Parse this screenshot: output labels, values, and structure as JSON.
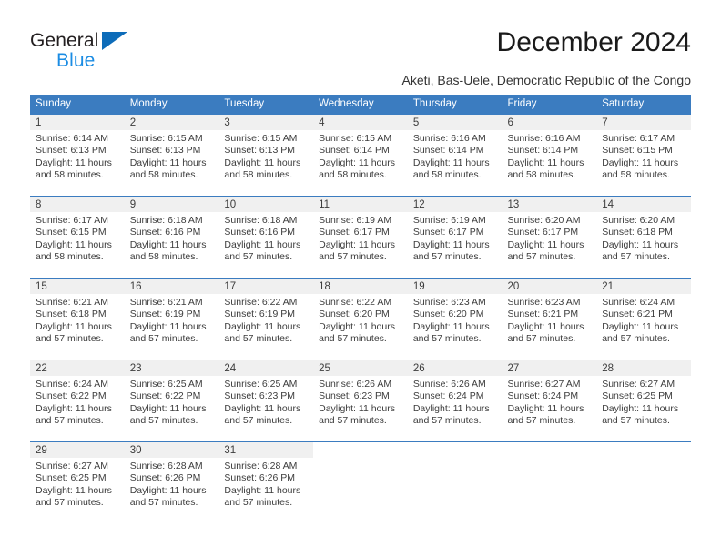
{
  "brand": {
    "name_part1": "General",
    "name_part2": "Blue",
    "accent_color": "#0d6cb9",
    "secondary_color": "#1b8ce3"
  },
  "header": {
    "title": "December 2024",
    "location": "Aketi, Bas-Uele, Democratic Republic of the Congo"
  },
  "theme": {
    "header_row_color": "#3b7cc0",
    "day_band_color": "#f0f0f0",
    "text_color": "#3c3c3c"
  },
  "calendar": {
    "weekdays": [
      "Sunday",
      "Monday",
      "Tuesday",
      "Wednesday",
      "Thursday",
      "Friday",
      "Saturday"
    ],
    "weeks": [
      [
        {
          "day": "1",
          "sunrise": "Sunrise: 6:14 AM",
          "sunset": "Sunset: 6:13 PM",
          "daylight": "Daylight: 11 hours and 58 minutes."
        },
        {
          "day": "2",
          "sunrise": "Sunrise: 6:15 AM",
          "sunset": "Sunset: 6:13 PM",
          "daylight": "Daylight: 11 hours and 58 minutes."
        },
        {
          "day": "3",
          "sunrise": "Sunrise: 6:15 AM",
          "sunset": "Sunset: 6:13 PM",
          "daylight": "Daylight: 11 hours and 58 minutes."
        },
        {
          "day": "4",
          "sunrise": "Sunrise: 6:15 AM",
          "sunset": "Sunset: 6:14 PM",
          "daylight": "Daylight: 11 hours and 58 minutes."
        },
        {
          "day": "5",
          "sunrise": "Sunrise: 6:16 AM",
          "sunset": "Sunset: 6:14 PM",
          "daylight": "Daylight: 11 hours and 58 minutes."
        },
        {
          "day": "6",
          "sunrise": "Sunrise: 6:16 AM",
          "sunset": "Sunset: 6:14 PM",
          "daylight": "Daylight: 11 hours and 58 minutes."
        },
        {
          "day": "7",
          "sunrise": "Sunrise: 6:17 AM",
          "sunset": "Sunset: 6:15 PM",
          "daylight": "Daylight: 11 hours and 58 minutes."
        }
      ],
      [
        {
          "day": "8",
          "sunrise": "Sunrise: 6:17 AM",
          "sunset": "Sunset: 6:15 PM",
          "daylight": "Daylight: 11 hours and 58 minutes."
        },
        {
          "day": "9",
          "sunrise": "Sunrise: 6:18 AM",
          "sunset": "Sunset: 6:16 PM",
          "daylight": "Daylight: 11 hours and 58 minutes."
        },
        {
          "day": "10",
          "sunrise": "Sunrise: 6:18 AM",
          "sunset": "Sunset: 6:16 PM",
          "daylight": "Daylight: 11 hours and 57 minutes."
        },
        {
          "day": "11",
          "sunrise": "Sunrise: 6:19 AM",
          "sunset": "Sunset: 6:17 PM",
          "daylight": "Daylight: 11 hours and 57 minutes."
        },
        {
          "day": "12",
          "sunrise": "Sunrise: 6:19 AM",
          "sunset": "Sunset: 6:17 PM",
          "daylight": "Daylight: 11 hours and 57 minutes."
        },
        {
          "day": "13",
          "sunrise": "Sunrise: 6:20 AM",
          "sunset": "Sunset: 6:17 PM",
          "daylight": "Daylight: 11 hours and 57 minutes."
        },
        {
          "day": "14",
          "sunrise": "Sunrise: 6:20 AM",
          "sunset": "Sunset: 6:18 PM",
          "daylight": "Daylight: 11 hours and 57 minutes."
        }
      ],
      [
        {
          "day": "15",
          "sunrise": "Sunrise: 6:21 AM",
          "sunset": "Sunset: 6:18 PM",
          "daylight": "Daylight: 11 hours and 57 minutes."
        },
        {
          "day": "16",
          "sunrise": "Sunrise: 6:21 AM",
          "sunset": "Sunset: 6:19 PM",
          "daylight": "Daylight: 11 hours and 57 minutes."
        },
        {
          "day": "17",
          "sunrise": "Sunrise: 6:22 AM",
          "sunset": "Sunset: 6:19 PM",
          "daylight": "Daylight: 11 hours and 57 minutes."
        },
        {
          "day": "18",
          "sunrise": "Sunrise: 6:22 AM",
          "sunset": "Sunset: 6:20 PM",
          "daylight": "Daylight: 11 hours and 57 minutes."
        },
        {
          "day": "19",
          "sunrise": "Sunrise: 6:23 AM",
          "sunset": "Sunset: 6:20 PM",
          "daylight": "Daylight: 11 hours and 57 minutes."
        },
        {
          "day": "20",
          "sunrise": "Sunrise: 6:23 AM",
          "sunset": "Sunset: 6:21 PM",
          "daylight": "Daylight: 11 hours and 57 minutes."
        },
        {
          "day": "21",
          "sunrise": "Sunrise: 6:24 AM",
          "sunset": "Sunset: 6:21 PM",
          "daylight": "Daylight: 11 hours and 57 minutes."
        }
      ],
      [
        {
          "day": "22",
          "sunrise": "Sunrise: 6:24 AM",
          "sunset": "Sunset: 6:22 PM",
          "daylight": "Daylight: 11 hours and 57 minutes."
        },
        {
          "day": "23",
          "sunrise": "Sunrise: 6:25 AM",
          "sunset": "Sunset: 6:22 PM",
          "daylight": "Daylight: 11 hours and 57 minutes."
        },
        {
          "day": "24",
          "sunrise": "Sunrise: 6:25 AM",
          "sunset": "Sunset: 6:23 PM",
          "daylight": "Daylight: 11 hours and 57 minutes."
        },
        {
          "day": "25",
          "sunrise": "Sunrise: 6:26 AM",
          "sunset": "Sunset: 6:23 PM",
          "daylight": "Daylight: 11 hours and 57 minutes."
        },
        {
          "day": "26",
          "sunrise": "Sunrise: 6:26 AM",
          "sunset": "Sunset: 6:24 PM",
          "daylight": "Daylight: 11 hours and 57 minutes."
        },
        {
          "day": "27",
          "sunrise": "Sunrise: 6:27 AM",
          "sunset": "Sunset: 6:24 PM",
          "daylight": "Daylight: 11 hours and 57 minutes."
        },
        {
          "day": "28",
          "sunrise": "Sunrise: 6:27 AM",
          "sunset": "Sunset: 6:25 PM",
          "daylight": "Daylight: 11 hours and 57 minutes."
        }
      ],
      [
        {
          "day": "29",
          "sunrise": "Sunrise: 6:27 AM",
          "sunset": "Sunset: 6:25 PM",
          "daylight": "Daylight: 11 hours and 57 minutes."
        },
        {
          "day": "30",
          "sunrise": "Sunrise: 6:28 AM",
          "sunset": "Sunset: 6:26 PM",
          "daylight": "Daylight: 11 hours and 57 minutes."
        },
        {
          "day": "31",
          "sunrise": "Sunrise: 6:28 AM",
          "sunset": "Sunset: 6:26 PM",
          "daylight": "Daylight: 11 hours and 57 minutes."
        },
        {
          "day": "",
          "sunrise": "",
          "sunset": "",
          "daylight": ""
        },
        {
          "day": "",
          "sunrise": "",
          "sunset": "",
          "daylight": ""
        },
        {
          "day": "",
          "sunrise": "",
          "sunset": "",
          "daylight": ""
        },
        {
          "day": "",
          "sunrise": "",
          "sunset": "",
          "daylight": ""
        }
      ]
    ]
  }
}
